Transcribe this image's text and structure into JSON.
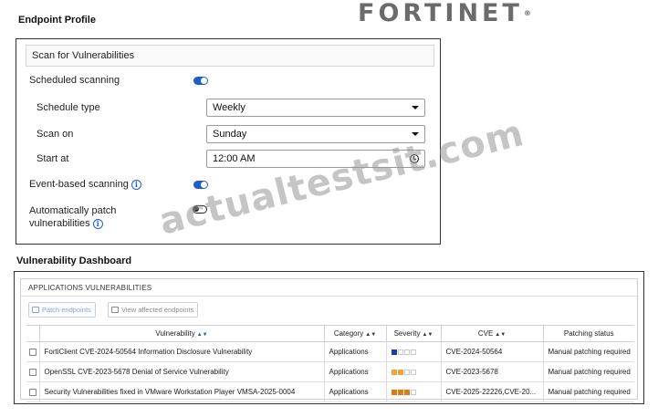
{
  "brand": {
    "logo_text": "FORTINET"
  },
  "endpoint_profile": {
    "title": "Endpoint Profile",
    "scan_header": "Scan for Vulnerabilities",
    "scheduled_scanning": {
      "label": "Scheduled scanning",
      "enabled": true
    },
    "schedule_type": {
      "label": "Schedule type",
      "value": "Weekly"
    },
    "scan_on": {
      "label": "Scan on",
      "value": "Sunday"
    },
    "start_at": {
      "label": "Start at",
      "value": "12:00 AM"
    },
    "event_based_scanning": {
      "label": "Event-based scanning",
      "enabled": true
    },
    "auto_patch": {
      "label_line1": "Automatically patch",
      "label_line2": "vulnerabilities",
      "enabled": false
    }
  },
  "dashboard": {
    "title": "Vulnerability Dashboard",
    "tab": "APPLICATIONS VULNERABILITIES",
    "patch_button": "Patch endpoints",
    "view_button": "View affected endpoints",
    "columns": [
      "Vulnerability",
      "Category",
      "Severity",
      "CVE",
      "Patching status"
    ],
    "rows": [
      {
        "vulnerability": "FortiClient CVE-2024-50564 Information Disclosure Vulnerability",
        "category": "Applications",
        "severity_level": 1,
        "severity_color": "#1c3f9e",
        "cve": "CVE-2024-50564",
        "status": "Manual patching required"
      },
      {
        "vulnerability": "OpenSSL CVE-2023-5678 Denial of Service Vulnerability",
        "category": "Applications",
        "severity_level": 2,
        "severity_color": "#f0a63a",
        "cve": "CVE-2023-5678",
        "status": "Manual patching required"
      },
      {
        "vulnerability": "Security Vulnerabilities fixed in VMware Workstation Player VMSA-2025-0004",
        "category": "Applications",
        "severity_level": 3,
        "severity_color": "#e07a12",
        "cve": "CVE-2025-22226,CVE-20...",
        "status": "Manual patching required"
      }
    ]
  },
  "watermark": "actualtestsit.com"
}
